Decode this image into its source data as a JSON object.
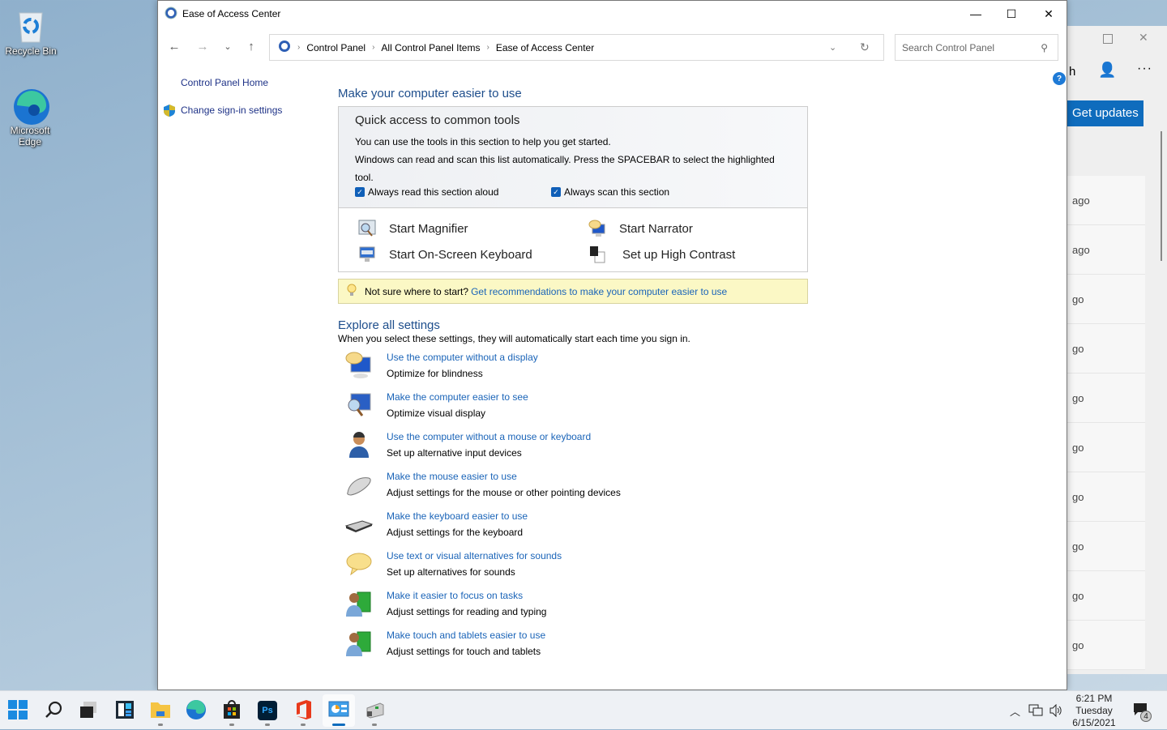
{
  "desktop": {
    "icons": [
      {
        "label": "Recycle Bin",
        "icon": "recycle-bin-icon"
      },
      {
        "label": "Microsoft Edge",
        "icon": "edge-icon"
      }
    ]
  },
  "background_window": {
    "partial_label": "h",
    "button": "Get updates",
    "rows": [
      "ago",
      "ago",
      "go",
      "go",
      "go",
      "go",
      "go",
      "go",
      "go",
      "go"
    ]
  },
  "window": {
    "title": "Ease of Access Center",
    "controls": {
      "minimize": "—",
      "maximize": "☐",
      "close": "✕"
    },
    "nav": {
      "back": "←",
      "forward": "→",
      "recent": "⌄",
      "up": "↑"
    },
    "breadcrumb": [
      "Control Panel",
      "All Control Panel Items",
      "Ease of Access Center"
    ],
    "search_placeholder": "Search Control Panel",
    "help": "?"
  },
  "sidebar": {
    "items": [
      {
        "label": "Control Panel Home"
      },
      {
        "label": "Change sign-in settings",
        "icon": "shield-icon"
      }
    ]
  },
  "main": {
    "heading": "Make your computer easier to use",
    "quick": {
      "title": "Quick access to common tools",
      "line1": "You can use the tools in this section to help you get started.",
      "line2": "Windows can read and scan this list automatically.  Press the SPACEBAR to select the highlighted tool.",
      "checkboxes": [
        {
          "label": "Always read this section aloud",
          "checked": true
        },
        {
          "label": "Always scan this section",
          "checked": true
        }
      ],
      "tools": [
        {
          "label": "Start Magnifier",
          "icon": "magnifier-icon"
        },
        {
          "label": "Start Narrator",
          "icon": "narrator-icon"
        },
        {
          "label": "Start On-Screen Keyboard",
          "icon": "keyboard-icon"
        },
        {
          "label": "Set up High Contrast",
          "icon": "high-contrast-icon"
        }
      ]
    },
    "tip": {
      "text": "Not sure where to start?",
      "link": "Get recommendations to make your computer easier to use"
    },
    "explore": {
      "heading": "Explore all settings",
      "subtitle": "When you select these settings, they will automatically start each time you sign in.",
      "items": [
        {
          "link": "Use the computer without a display",
          "desc": "Optimize for blindness",
          "icon": "narrator-monitor-icon"
        },
        {
          "link": "Make the computer easier to see",
          "desc": "Optimize visual display",
          "icon": "magnifier-monitor-icon"
        },
        {
          "link": "Use the computer without a mouse or keyboard",
          "desc": "Set up alternative input devices",
          "icon": "headset-person-icon"
        },
        {
          "link": "Make the mouse easier to use",
          "desc": "Adjust settings for the mouse or other pointing devices",
          "icon": "mouse-icon"
        },
        {
          "link": "Make the keyboard easier to use",
          "desc": "Adjust settings for the keyboard",
          "icon": "keyboard-icon"
        },
        {
          "link": "Use text or visual alternatives for sounds",
          "desc": "Set up alternatives for sounds",
          "icon": "speech-bubble-icon"
        },
        {
          "link": "Make it easier to focus on tasks",
          "desc": "Adjust settings for reading and typing",
          "icon": "person-book-icon"
        },
        {
          "link": "Make touch and tablets easier to use",
          "desc": "Adjust settings for touch and tablets",
          "icon": "person-book-icon"
        }
      ]
    }
  },
  "taskbar": {
    "apps": [
      "start",
      "search",
      "task-view",
      "widgets",
      "file-explorer",
      "edge",
      "store",
      "photoshop",
      "office",
      "control-panel",
      "device-manager"
    ],
    "clock": {
      "time": "6:21 PM",
      "day": "Tuesday",
      "date": "6/15/2021"
    },
    "notification_count": "4",
    "tray": {
      "chevron": "^",
      "volume": "🔊"
    }
  },
  "colors": {
    "link": "#1a64b8",
    "heading": "#1e4e8c",
    "tip_bg": "#fbf8c5",
    "accent": "#0f6cbd"
  }
}
